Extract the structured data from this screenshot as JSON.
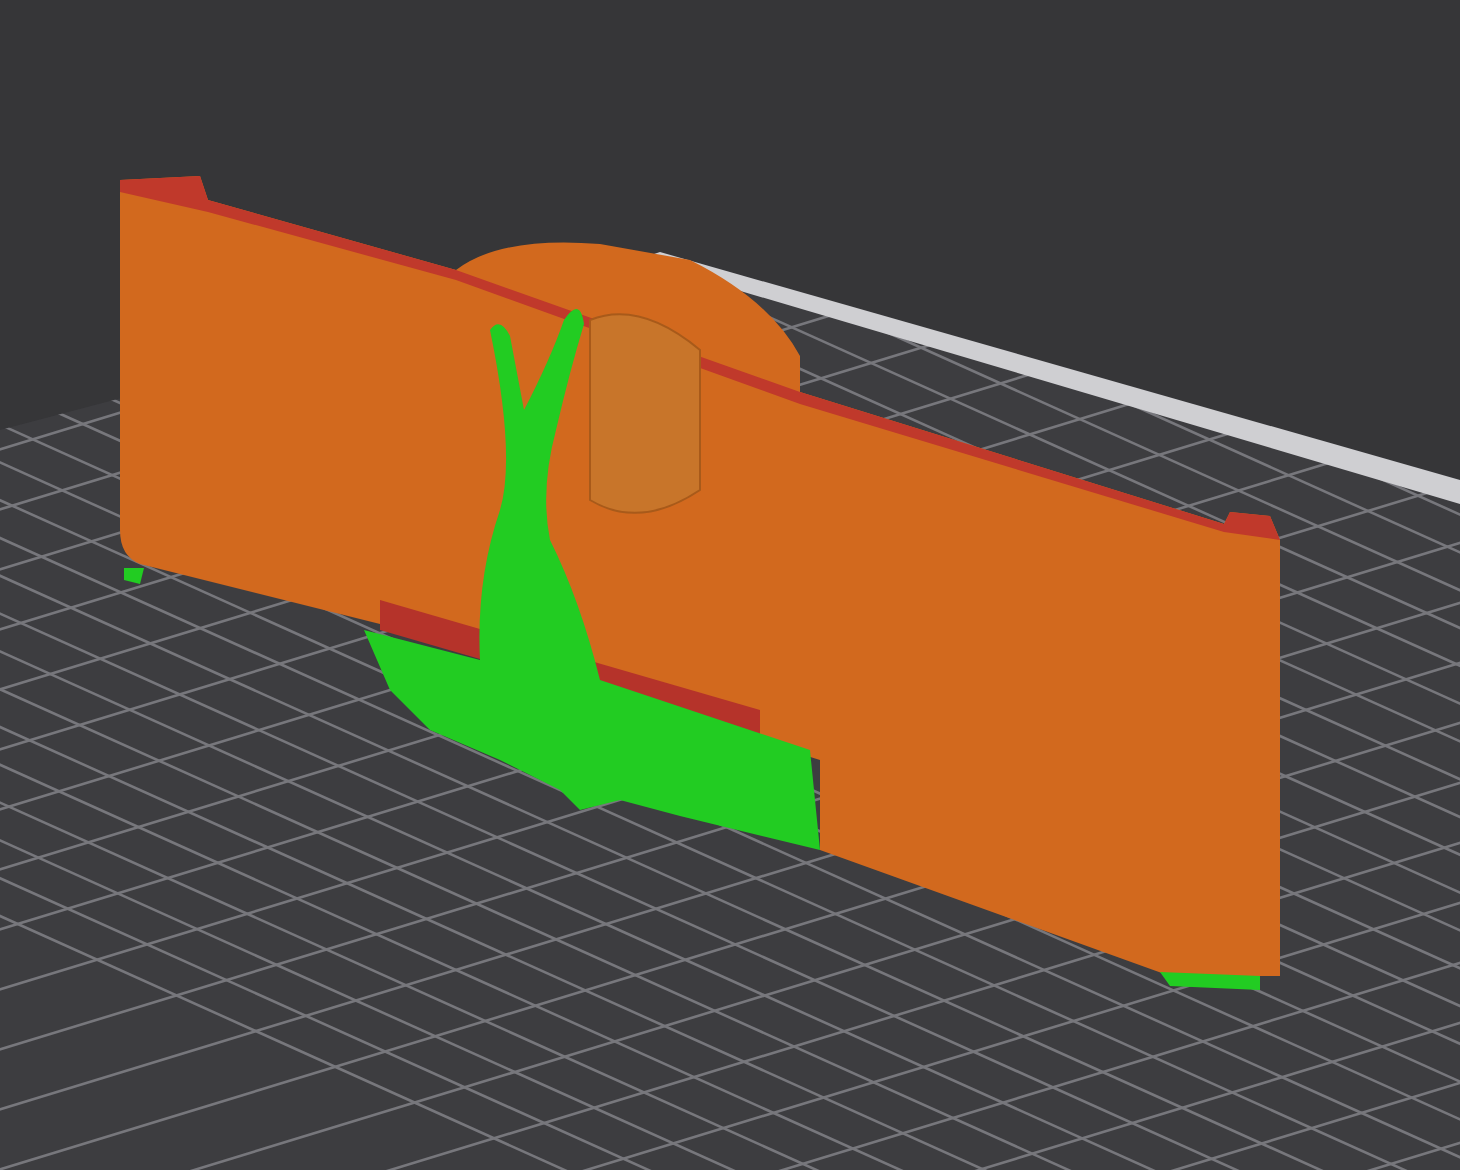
{
  "viewport": {
    "model_parts": [
      {
        "kind": "wall",
        "color": "#d2691e"
      },
      {
        "kind": "support",
        "color": "#22cc22"
      }
    ]
  }
}
